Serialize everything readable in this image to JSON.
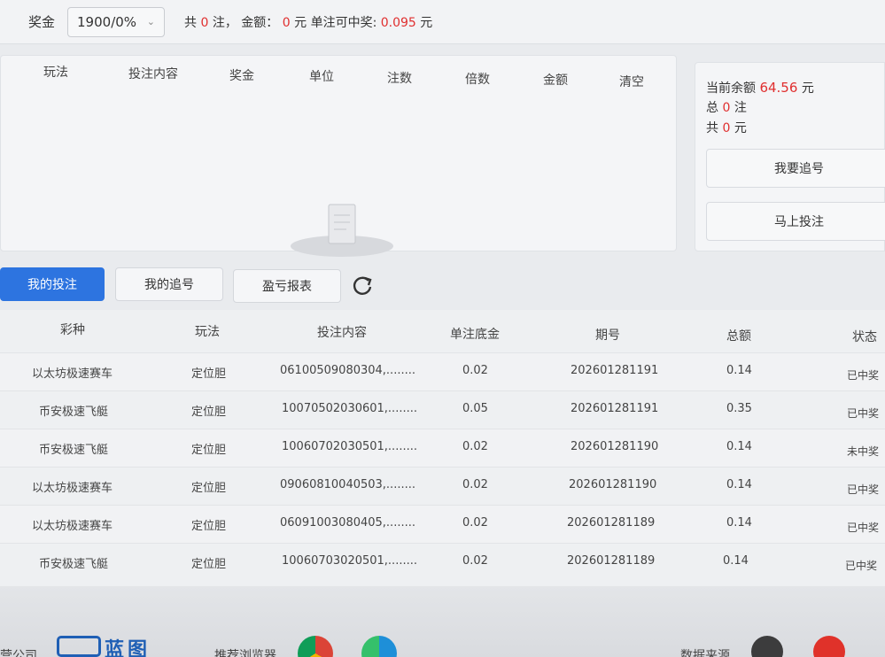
{
  "top": {
    "prize_label": "奖金",
    "prize_select": "1900/0%",
    "summary_prefix": "共",
    "count": "0",
    "summary_mid": "注，  金额：",
    "amount": "0",
    "summary_unit": "元",
    "single_label": "单注可中奖:",
    "single_value": "0.095",
    "single_unit": "元"
  },
  "bet_table": {
    "headers": [
      "玩法",
      "投注内容",
      "奖金",
      "单位",
      "注数",
      "倍数",
      "金额",
      "清空"
    ]
  },
  "side": {
    "balance_label": "当前余额",
    "balance_value": "64.56",
    "balance_unit": "元",
    "total_label": "总",
    "total_value": "0",
    "total_unit": "注",
    "sum_label": "共",
    "sum_value": "0",
    "sum_unit": "元",
    "chase_button": "我要追号",
    "bet_button": "马上投注"
  },
  "tabs": {
    "my_bets": "我的投注",
    "my_chase": "我的追号",
    "pnl": "盈亏报表"
  },
  "records": {
    "headers": [
      "彩种",
      "玩法",
      "投注内容",
      "单注底金",
      "期号",
      "总额",
      "状态"
    ],
    "rows": [
      [
        "以太坊极速赛车",
        "定位胆",
        "06100509080304,........",
        "0.02",
        "202601281191",
        "0.14",
        "已中奖"
      ],
      [
        "币安极速飞艇",
        "定位胆",
        "10070502030601,........",
        "0.05",
        "202601281191",
        "0.35",
        "已中奖"
      ],
      [
        "币安极速飞艇",
        "定位胆",
        "10060702030501,........",
        "0.02",
        "202601281190",
        "0.14",
        "未中奖"
      ],
      [
        "以太坊极速赛车",
        "定位胆",
        "09060810040503,........",
        "0.02",
        "202601281190",
        "0.14",
        "已中奖"
      ],
      [
        "以太坊极速赛车",
        "定位胆",
        "06091003080405,........",
        "0.02",
        "202601281189",
        "0.14",
        "已中奖"
      ],
      [
        "币安极速飞艇",
        "定位胆",
        "10060703020501,........",
        "0.02",
        "202601281189",
        "0.14",
        "已中奖"
      ]
    ]
  },
  "footer": {
    "company": "营公司",
    "logo_text": "蓝图",
    "browser_label": "推荐浏览器",
    "source_label": "数据来源"
  },
  "colors": {
    "accent": "#2d74e0",
    "win": "#e02f2f",
    "lose": "#2aa52a"
  }
}
